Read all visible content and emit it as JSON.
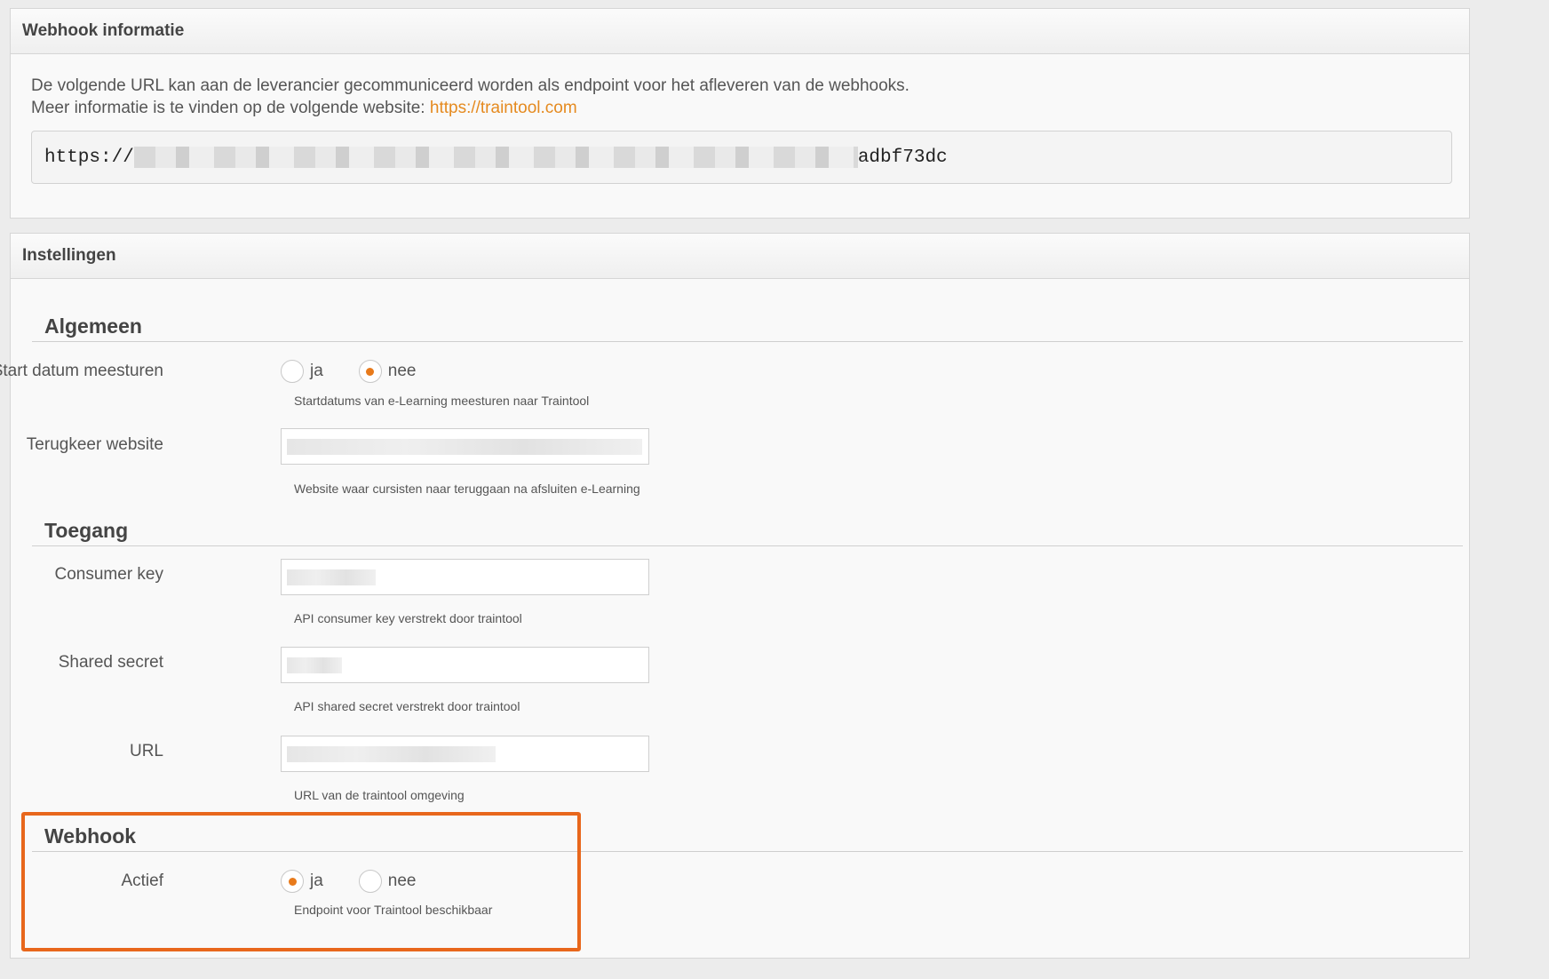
{
  "webhook_info": {
    "title": "Webhook informatie",
    "line1": "De volgende URL kan aan de leverancier gecommuniceerd worden als endpoint voor het afleveren van de webhooks.",
    "line2_prefix": "Meer informatie is te vinden op de volgende website: ",
    "link": "https://traintool.com",
    "url_start": "https://",
    "url_end": "adbf73dc"
  },
  "settings": {
    "title": "Instellingen",
    "algemeen": {
      "title": "Algemeen",
      "start_datum_label": "Start datum meesturen",
      "opt_ja": "ja",
      "opt_nee": "nee",
      "start_datum_selected": "nee",
      "start_datum_help": "Startdatums van e-Learning meesturen naar Traintool",
      "terugkeer_label": "Terugkeer website",
      "terugkeer_help": "Website waar cursisten naar teruggaan na afsluiten e-Learning"
    },
    "toegang": {
      "title": "Toegang",
      "consumer_key_label": "Consumer key",
      "consumer_key_help": "API consumer key verstrekt door traintool",
      "shared_secret_label": "Shared secret",
      "shared_secret_help": "API shared secret verstrekt door traintool",
      "url_label": "URL",
      "url_help": "URL van de traintool omgeving"
    },
    "webhook": {
      "title": "Webhook",
      "actief_label": "Actief",
      "opt_ja": "ja",
      "opt_nee": "nee",
      "actief_selected": "ja",
      "actief_help": "Endpoint voor Traintool beschikbaar"
    }
  },
  "colors": {
    "accent": "#e87a1b",
    "link": "#e58a1f",
    "highlight": "#e8671c"
  }
}
